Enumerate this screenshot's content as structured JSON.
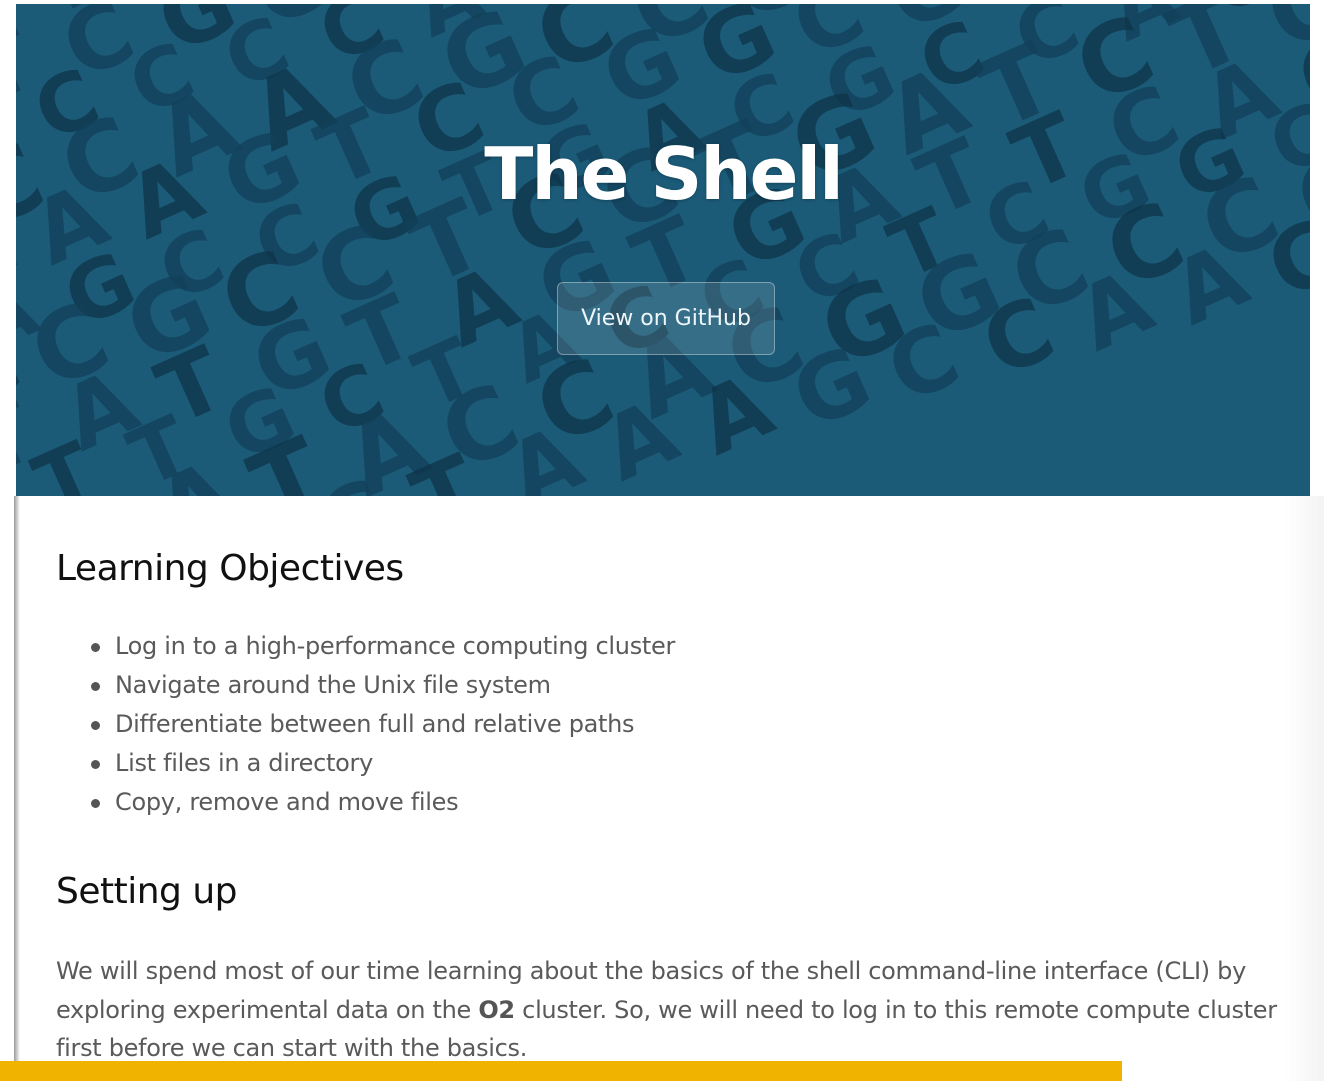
{
  "hero": {
    "title": "The Shell",
    "github_button": "View on GitHub",
    "background_color": "#1d5f7a",
    "background_letters": "TTCACGTTTGCTACCCTCGGCGAGATACCACGGCCCCACATTCTAAAGCCAACGCCGGTTACGAAAAGTCCGGCGCCGGAAGCCGTGACGCCAGTGGCGCCTCCTGATCTGGTATGTAGTGA",
    "accent_colors": {
      "bar": "#f0b400"
    }
  },
  "objectives": {
    "heading": "Learning Objectives",
    "items": [
      "Log in to a high-performance computing cluster",
      "Navigate around the Unix file system",
      "Differentiate between full and relative paths",
      "List files in a directory",
      "Copy, remove and move files"
    ]
  },
  "setup": {
    "heading": "Setting up",
    "text_before": "We will spend most of our time learning about the basics of the shell command-line interface (CLI) by exploring experimental data on the ",
    "bold": "O2",
    "text_after": " cluster. So, we will need to log in to this remote compute cluster first before we can start with the basics."
  }
}
